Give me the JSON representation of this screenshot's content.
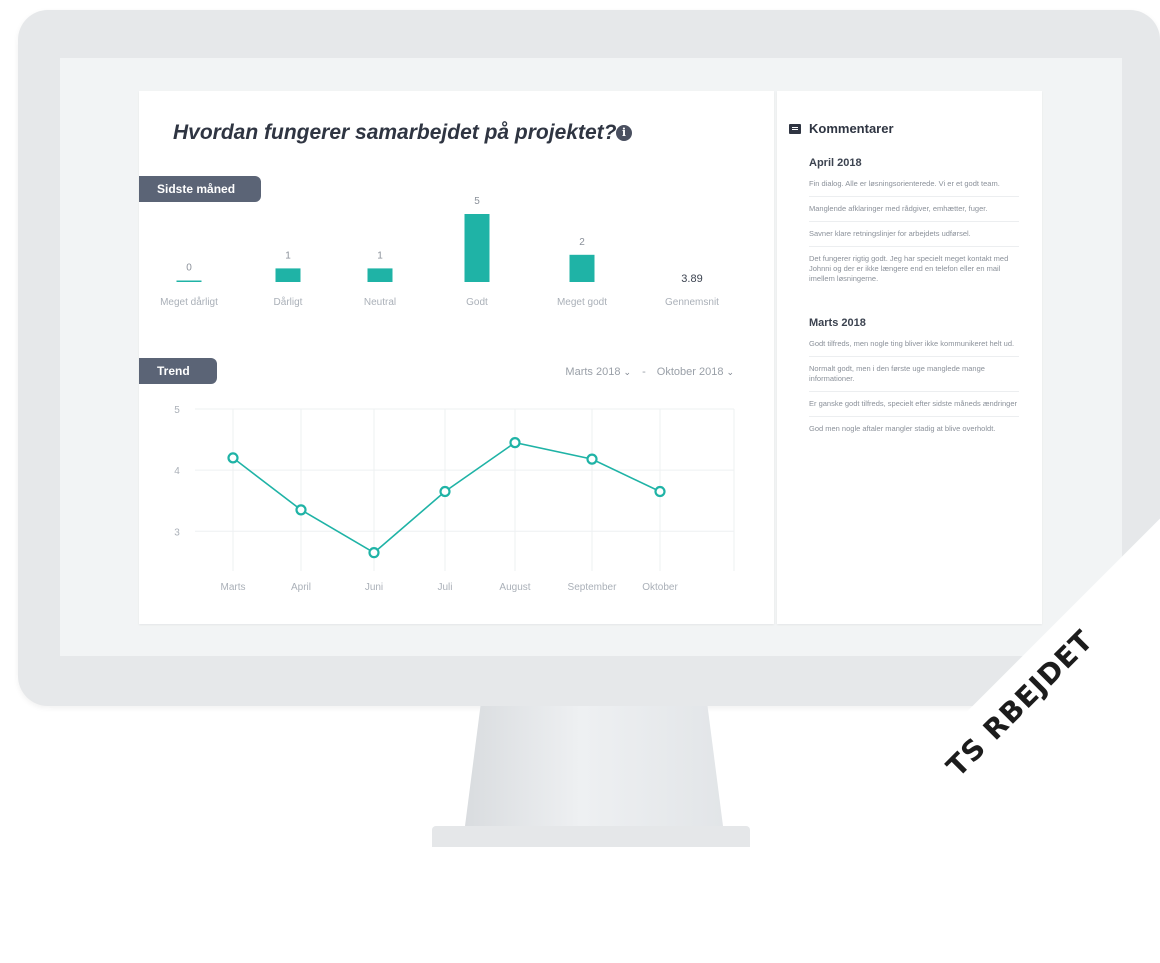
{
  "page_title": "Hvordan fungerer samarbejdet på projektet?",
  "info_icon": "i",
  "sections": {
    "last_month": "Sidste måned",
    "trend": "Trend"
  },
  "date_range": {
    "from": "Marts 2018",
    "separator": "-",
    "to": "Oktober 2018",
    "chevron": "⌄"
  },
  "colors": {
    "accent": "#1fb3a6",
    "tag": "#5b6476",
    "title": "#2f3542"
  },
  "chart_data": [
    {
      "type": "bar",
      "categories": [
        "Meget dårligt",
        "Dårligt",
        "Neutral",
        "Godt",
        "Meget godt"
      ],
      "values": [
        0,
        1,
        1,
        5,
        2
      ],
      "average": {
        "label": "Gennemsnit",
        "value": "3.89"
      },
      "ylim": [
        0,
        5
      ]
    },
    {
      "type": "line",
      "x": [
        "Marts",
        "April",
        "Juni",
        "Juli",
        "August",
        "September",
        "Oktober"
      ],
      "values": [
        4.2,
        3.35,
        2.65,
        3.65,
        4.45,
        4.18,
        3.65
      ],
      "yticks": [
        5,
        4,
        3
      ],
      "ylim": [
        2.35,
        5
      ],
      "grid": true
    }
  ],
  "comments": {
    "title": "Kommentarer",
    "months": [
      {
        "label": "April 2018",
        "items": [
          "Fin dialog. Alle er løsningsorienterede. Vi er et godt team.",
          "Manglende afklaringer med rådgiver, emhætter, fuger.",
          "Savner klare retningslinjer for arbejdets udførsel.",
          "Det fungerer rigtig godt. Jeg har specielt meget kontakt med Johnni og der er ikke længere end en telefon eller en mail imellem løsningerne."
        ]
      },
      {
        "label": "Marts 2018",
        "items": [
          "Godt tilfreds, men nogle ting bliver ikke kommunikeret helt ud.",
          "Normalt godt, men i den første uge manglede mange informationer.",
          "Er ganske godt tilfreds, specielt efter sidste måneds ændringer",
          "God men nogle aftaler mangler stadig at blive overholdt."
        ]
      }
    ]
  },
  "watermark": "TS   RBEJDET"
}
